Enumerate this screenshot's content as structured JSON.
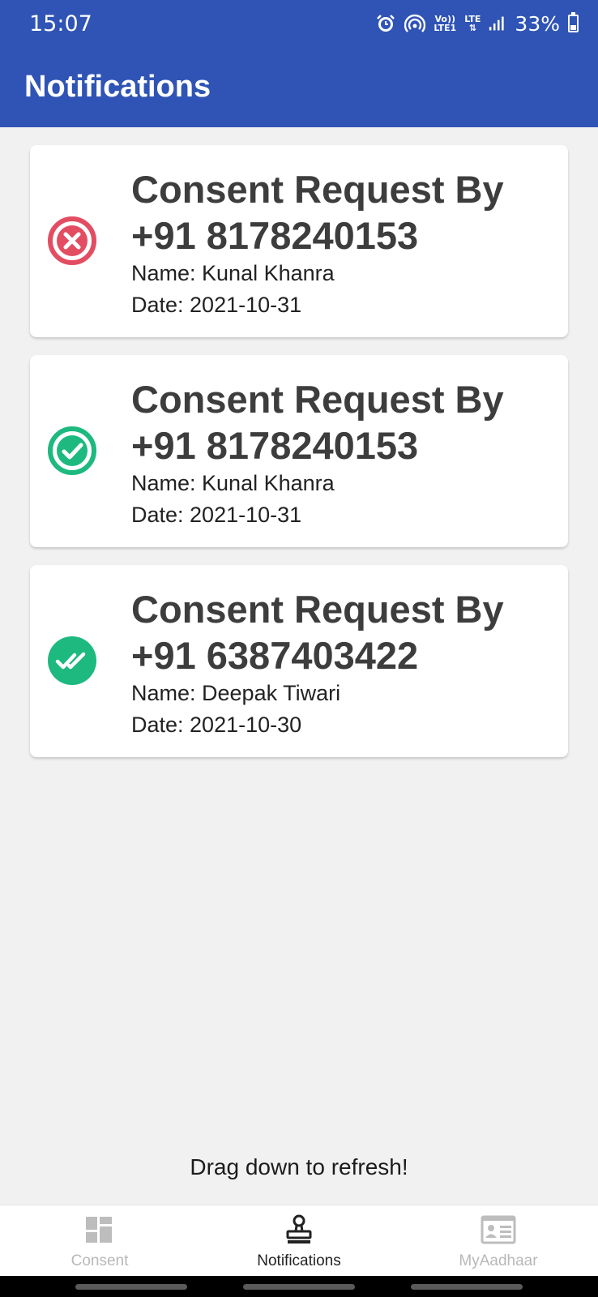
{
  "status_bar": {
    "time": "15:07",
    "volte_label_1": "Vo))",
    "volte_label_2": "LTE1",
    "lte_label": "LTE",
    "battery": "33%"
  },
  "app_bar": {
    "title": "Notifications"
  },
  "notifications": [
    {
      "status": "rejected",
      "status_icon": "x-circle-icon",
      "status_color": "#e34d62",
      "title_line1": "Consent Request By",
      "title_line2": "+91 8178240153",
      "name": "Name: Kunal Khanra",
      "date": "Date: 2021-10-31"
    },
    {
      "status": "approved",
      "status_icon": "check-circle-icon",
      "status_color": "#1db97f",
      "title_line1": "Consent Request By",
      "title_line2": "+91 8178240153",
      "name": "Name: Kunal Khanra",
      "date": "Date: 2021-10-31"
    },
    {
      "status": "completed",
      "status_icon": "double-check-icon",
      "status_color": "#1db97f",
      "title_line1": "Consent Request By",
      "title_line2": "+91 6387403422",
      "name": "Name: Deepak Tiwari",
      "date": "Date: 2021-10-30"
    }
  ],
  "refresh_hint": "Drag down to refresh!",
  "bottom_nav": [
    {
      "label": "Consent",
      "icon": "dashboard-icon",
      "active": false
    },
    {
      "label": "Notifications",
      "icon": "stamp-icon",
      "active": true
    },
    {
      "label": "MyAadhaar",
      "icon": "id-card-icon",
      "active": false
    }
  ],
  "colors": {
    "app_bar": "#2f54b5",
    "background": "#f1f1f1",
    "rejected": "#e34d62",
    "approved": "#1db97f"
  }
}
